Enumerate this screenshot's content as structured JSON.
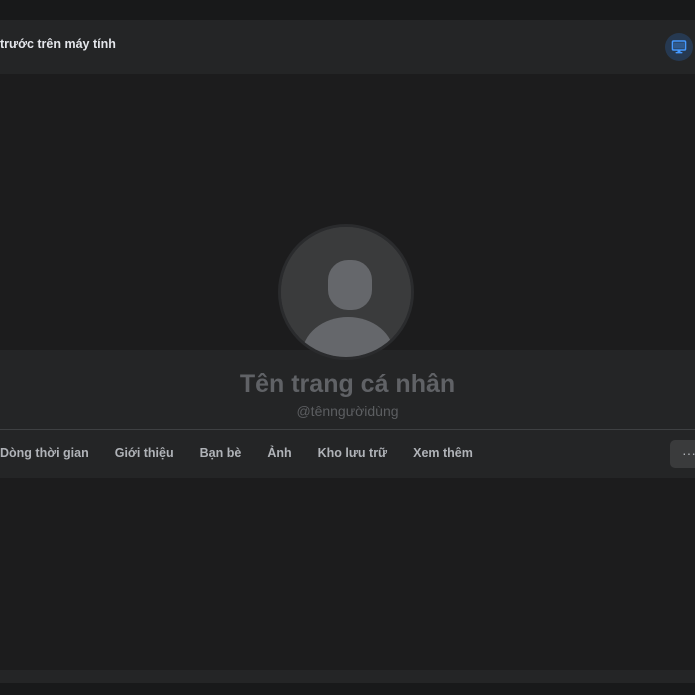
{
  "preview_bar": {
    "title": "trước trên máy tính",
    "desktop_icon": "desktop-monitor-icon"
  },
  "profile": {
    "name": "Tên trang cá nhân",
    "username": "@tênngườidùng",
    "avatar_icon": "default-user-silhouette-icon"
  },
  "tabs": [
    {
      "label": "Dòng thời gian"
    },
    {
      "label": "Giới thiệu"
    },
    {
      "label": "Bạn bè"
    },
    {
      "label": "Ảnh"
    },
    {
      "label": "Kho lưu trữ"
    },
    {
      "label": "Xem thêm"
    }
  ],
  "more_button": {
    "label": "···",
    "icon": "more-options-icon"
  },
  "colors": {
    "page_background": "#1c1c1d",
    "panel_background": "#242526",
    "accent": "#4599ff"
  }
}
